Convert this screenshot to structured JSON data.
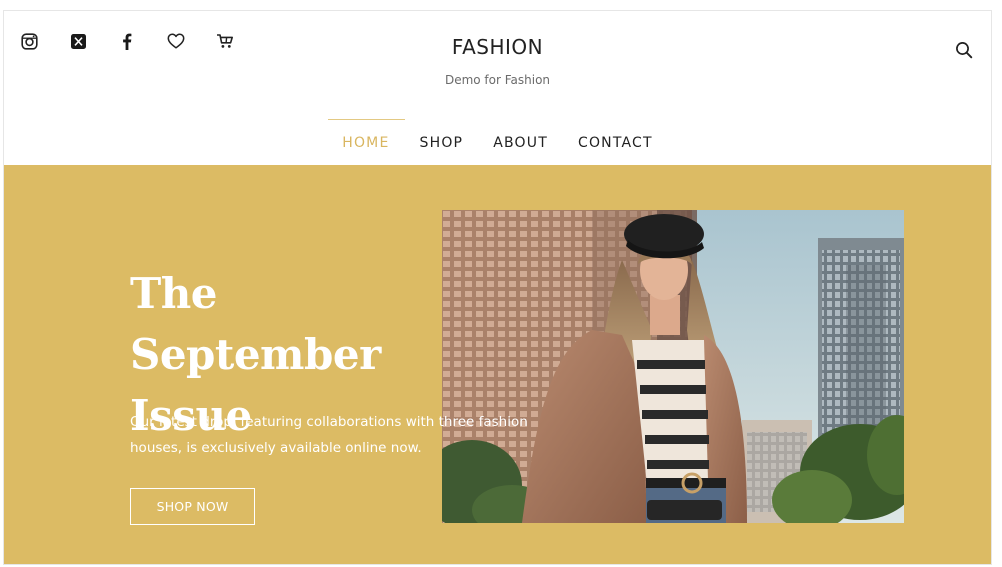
{
  "header": {
    "social_icons": [
      "instagram-icon",
      "x-icon",
      "facebook-icon",
      "heart-icon",
      "cart-icon"
    ],
    "brand_title": "FASHION",
    "brand_subtitle": "Demo for Fashion",
    "search_icon": "search-icon"
  },
  "nav": {
    "items": [
      {
        "label": "HOME",
        "active": true
      },
      {
        "label": "SHOP",
        "active": false
      },
      {
        "label": "ABOUT",
        "active": false
      },
      {
        "label": "CONTACT",
        "active": false
      }
    ]
  },
  "hero": {
    "title": "The September\nIssue",
    "text": "Our latest drop, featuring collaborations with three fashion houses, is exclusively available online now.",
    "button_label": "SHOP NOW"
  },
  "colors": {
    "accent": "#d9b660",
    "hero_background": "#dcbb64",
    "text_dark": "#222222"
  }
}
